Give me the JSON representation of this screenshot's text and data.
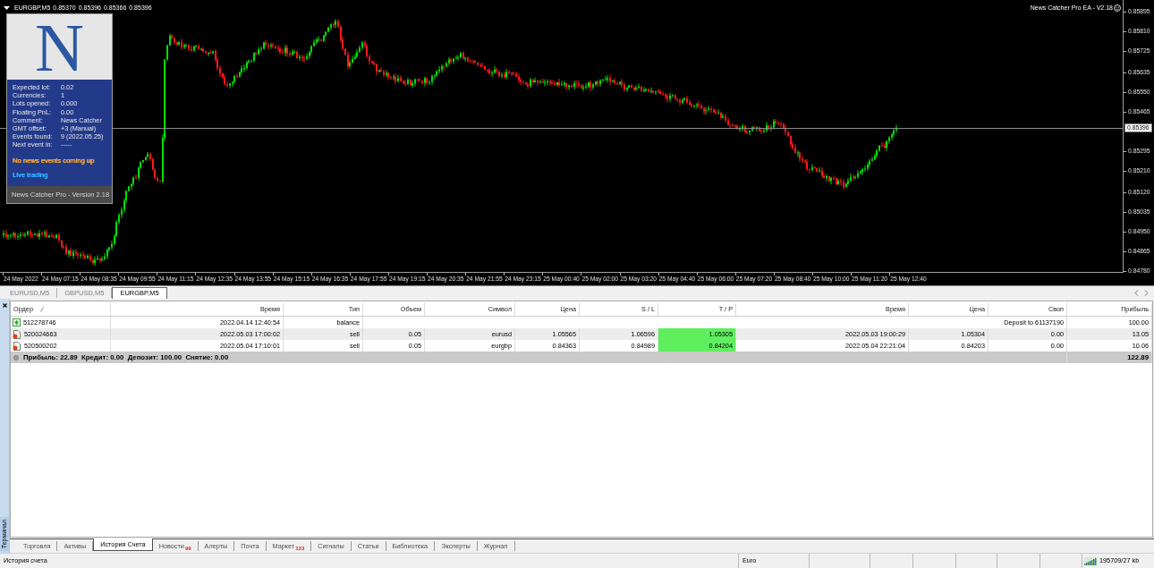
{
  "chart": {
    "symbol": "EURGBP,M5",
    "quotes": [
      "0.85370",
      "0.85396",
      "0.85366",
      "0.85396"
    ],
    "expert_label": "News Catcher Pro EA - V2.18",
    "price_ticks": [
      "0.85895",
      "0.85810",
      "0.85725",
      "0.85635",
      "0.85550",
      "0.85465",
      "0.85295",
      "0.85210",
      "0.85120",
      "0.85035",
      "0.84950",
      "0.84865",
      "0.84780"
    ],
    "current_price": "0.85396",
    "time_ticks": [
      "24 May 2022",
      "24 May 07:15",
      "24 May 08:35",
      "24 May 09:55",
      "24 May 11:15",
      "24 May 12:35",
      "24 May 13:55",
      "24 May 15:15",
      "24 May 16:35",
      "24 May 17:55",
      "24 May 19:15",
      "24 May 20:35",
      "24 May 21:55",
      "24 May 23:15",
      "25 May 00:40",
      "25 May 02:00",
      "25 May 03:20",
      "25 May 04:40",
      "25 May 06:00",
      "25 May 07:20",
      "25 May 08:40",
      "25 May 10:00",
      "25 May 11:20",
      "25 May 12:40"
    ],
    "panel": {
      "logo_text": "N",
      "rows": [
        {
          "label": "Expected lot:",
          "value": "0.02"
        },
        {
          "label": "Currencies:",
          "value": "1"
        },
        {
          "label": "Lots opened:",
          "value": "0.000"
        },
        {
          "label": "Floating PnL:",
          "value": "0.00"
        },
        {
          "label": "Comment:",
          "value": "News Catcher"
        },
        {
          "label": "GMT offset:",
          "value": "+3 (Manual)"
        },
        {
          "label": "Events found:",
          "value": "9 (2022.05.25)"
        },
        {
          "label": "Next event in:",
          "value": "-----"
        }
      ],
      "notices": [
        {
          "text": "No news events coming up",
          "color": "#eea33a"
        },
        {
          "text": "Live trading",
          "color": "#33aaff"
        }
      ],
      "footer": "News Catcher Pro - Version 2.18"
    }
  },
  "chart_tabs": [
    {
      "label": "EURUSD,M5",
      "selected": false
    },
    {
      "label": "GBPUSD,M5",
      "selected": false
    },
    {
      "label": "EURGBP,M5",
      "selected": true
    }
  ],
  "terminal": {
    "title": "Терминал",
    "columns": [
      {
        "label": "Ордер",
        "sorted": true
      },
      {
        "label": "Время",
        "sorted": false
      },
      {
        "label": "Тип",
        "sorted": false
      },
      {
        "label": "Объем",
        "sorted": false
      },
      {
        "label": "Символ",
        "sorted": false
      },
      {
        "label": "Цена",
        "sorted": false
      },
      {
        "label": "S / L",
        "sorted": false
      },
      {
        "label": "T / P",
        "sorted": false
      },
      {
        "label": "Время",
        "sorted": false
      },
      {
        "label": "Цена",
        "sorted": false
      },
      {
        "label": "Своп",
        "sorted": false
      },
      {
        "label": "Прибыль",
        "sorted": false
      }
    ],
    "rows": [
      {
        "kind": "balance",
        "order": "512278746",
        "time": "2022.04.14 12:40:54",
        "type": "balance",
        "comment": "Deposit to 61137190",
        "profit": "100.00"
      },
      {
        "kind": "trade",
        "order": "520024663",
        "time": "2022.05.03 17:00:02",
        "type": "sell",
        "volume": "0.05",
        "symbol": "eurusd",
        "price": "1.05565",
        "sl": "1.06596",
        "tp": "1.05305",
        "tp_hit": true,
        "close_time": "2022.05.03 19:00:29",
        "close_price": "1.05304",
        "swap": "0.00",
        "profit": "13.05"
      },
      {
        "kind": "trade",
        "order": "520500202",
        "time": "2022.05.04 17:10:01",
        "type": "sell",
        "volume": "0.05",
        "symbol": "eurgbp",
        "price": "0.84363",
        "sl": "0.84989",
        "tp": "0.84204",
        "tp_hit": true,
        "close_time": "2022.05.04 22:21:04",
        "close_price": "0.84203",
        "swap": "0.00",
        "profit": "10.06"
      }
    ],
    "summary": {
      "text": "Прибыль: 22.89  Кредит: 0.00  Депозит: 100.00  Снятие: 0.00",
      "total": "122.89"
    },
    "tabs": [
      {
        "label": "Торговля",
        "selected": false
      },
      {
        "label": "Активы",
        "selected": false
      },
      {
        "label": "История Счета",
        "selected": true
      },
      {
        "label": "Новости",
        "badge": "99",
        "selected": false
      },
      {
        "label": "Алерты",
        "selected": false
      },
      {
        "label": "Почта",
        "selected": false
      },
      {
        "label": "Маркет",
        "badge": "133",
        "selected": false
      },
      {
        "label": "Сигналы",
        "selected": false
      },
      {
        "label": "Статьи",
        "selected": false
      },
      {
        "label": "Библиотека",
        "selected": false
      },
      {
        "label": "Эксперты",
        "selected": false
      },
      {
        "label": "Журнал",
        "selected": false
      }
    ]
  },
  "status_bar": {
    "text": "История счета",
    "currency": "Euro",
    "traffic": "195709/27 kb"
  }
}
